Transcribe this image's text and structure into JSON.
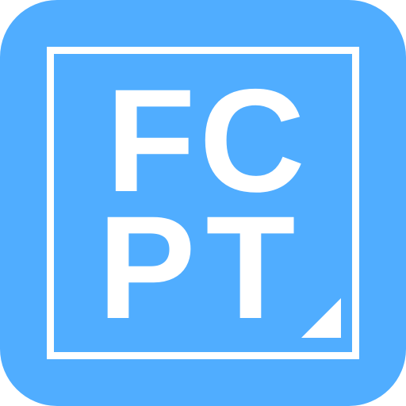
{
  "icon": {
    "letters": [
      "F",
      "C",
      "P",
      "T"
    ],
    "background_color": "#50adff",
    "foreground_color": "#ffffff",
    "corner_mark": "page-fold-icon"
  }
}
